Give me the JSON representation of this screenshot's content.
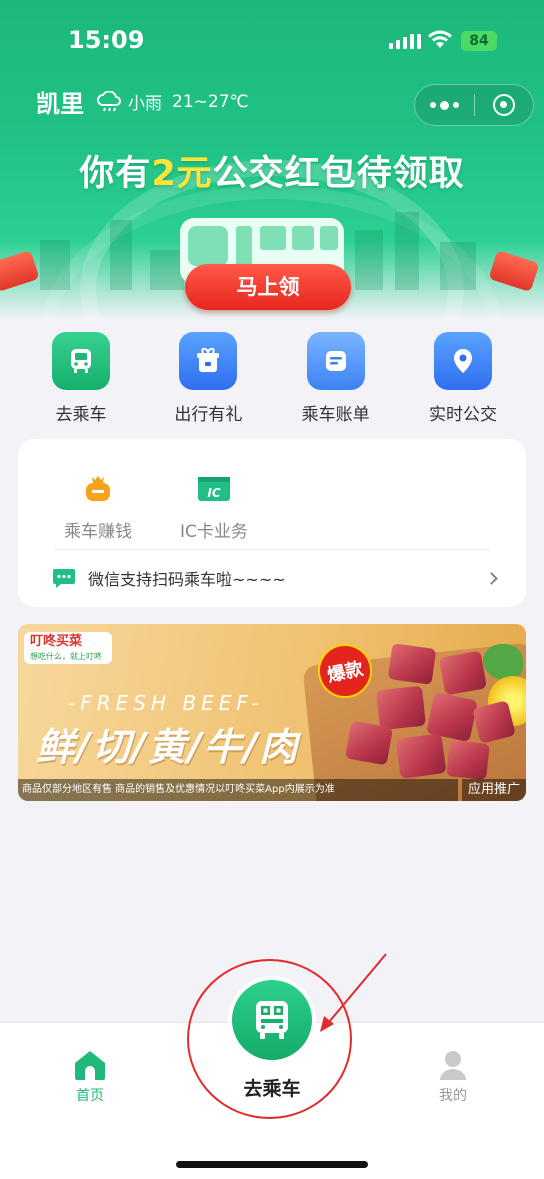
{
  "status_bar": {
    "time": "15:09",
    "battery": "84"
  },
  "header": {
    "city": "凯里",
    "weather_icon": "cloud-rain-icon",
    "condition": "小雨",
    "temperature": "21~27℃"
  },
  "banner": {
    "headline_prefix": "你有",
    "headline_amount": "2元",
    "headline_suffix": "公交红包待领取",
    "claim_button": "马上领",
    "accent_color": "#ffe43a"
  },
  "quick_actions": [
    {
      "label": "去乘车",
      "icon": "bus-icon"
    },
    {
      "label": "出行有礼",
      "icon": "gift-icon"
    },
    {
      "label": "乘车账单",
      "icon": "bill-icon"
    },
    {
      "label": "实时公交",
      "icon": "location-pin-icon"
    }
  ],
  "services": [
    {
      "label": "乘车赚钱",
      "icon": "money-bag-icon"
    },
    {
      "label": "IC卡业务",
      "icon": "ic-card-icon"
    }
  ],
  "notice": {
    "text": "微信支持扫码乘车啦~~~~"
  },
  "ad": {
    "brand": "叮咚买菜",
    "brand_slogan": "想吃什么，就上叮咚",
    "subtitle": "-FRESH BEEF-",
    "title": "鲜/切/黄/牛/肉",
    "badge": "爆款",
    "disclaimer": "商品仅部分地区有售 商品的销售及优惠情况以叮咚买菜App内展示为准",
    "tag": "应用推广"
  },
  "tabbar": {
    "home": "首页",
    "center": "去乘车",
    "me": "我的",
    "active_color": "#21b97a"
  }
}
